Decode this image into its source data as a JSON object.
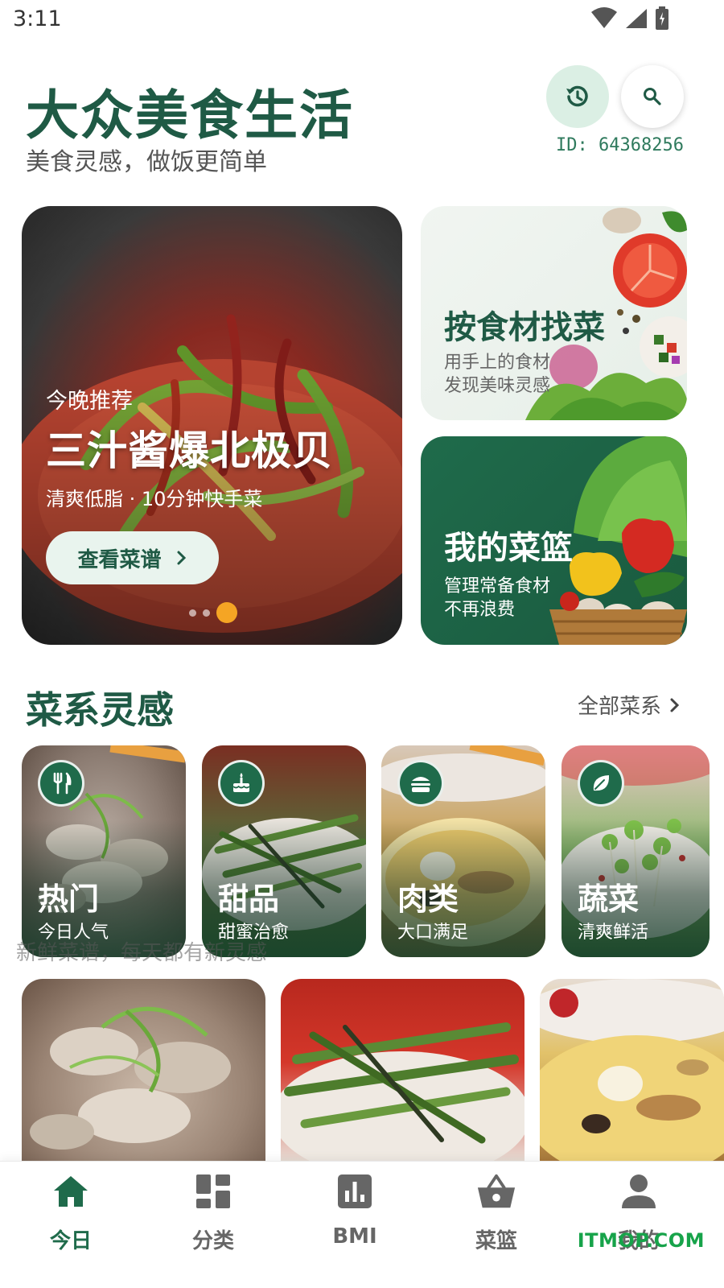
{
  "status_bar": {
    "time": "3:11",
    "icons": [
      "wifi-icon",
      "signal-icon",
      "battery-icon"
    ]
  },
  "header": {
    "title": "大众美食生活",
    "subtitle": "美食灵感，做饭更简单",
    "user_id": "ID:  64368256",
    "buttons": [
      "history-icon",
      "search-icon"
    ]
  },
  "hero": {
    "kicker": "今晚推荐",
    "title": "三汁酱爆北极贝",
    "description": "清爽低脂 · 10分钟快手菜",
    "cta_label": "查看菜谱",
    "carousel": {
      "count": 3,
      "active_index": 2
    }
  },
  "features": [
    {
      "title": "按食材找菜",
      "subtitle_line1": "用手上的食材",
      "subtitle_line2": "发现美味灵感"
    },
    {
      "title": "我的菜篮",
      "subtitle_line1": "管理常备食材",
      "subtitle_line2": "不再浪费"
    }
  ],
  "section": {
    "title": "菜系灵感",
    "more_label": "全部菜系"
  },
  "cuisines": [
    {
      "name": "热门",
      "subtitle": "今日人气",
      "icon": "utensils-icon"
    },
    {
      "name": "甜品",
      "subtitle": "甜蜜治愈",
      "icon": "cake-icon"
    },
    {
      "name": "肉类",
      "subtitle": "大口满足",
      "icon": "burger-icon"
    },
    {
      "name": "蔬菜",
      "subtitle": "清爽鲜活",
      "icon": "leaf-icon"
    }
  ],
  "tagline": "新鲜菜谱，每天都有新灵感",
  "bottom_nav": [
    {
      "label": "今日",
      "icon": "home-icon",
      "active": true
    },
    {
      "label": "分类",
      "icon": "grid-icon",
      "active": false
    },
    {
      "label": "BMI",
      "icon": "chart-icon",
      "active": false
    },
    {
      "label": "菜篮",
      "icon": "basket-icon",
      "active": false
    },
    {
      "label": "我的",
      "icon": "user-icon",
      "active": false
    }
  ],
  "watermark": "ITMOP.COM",
  "colors": {
    "primary": "#1f5a45",
    "accent": "#f5a524",
    "soft_green": "#dbefe4"
  }
}
